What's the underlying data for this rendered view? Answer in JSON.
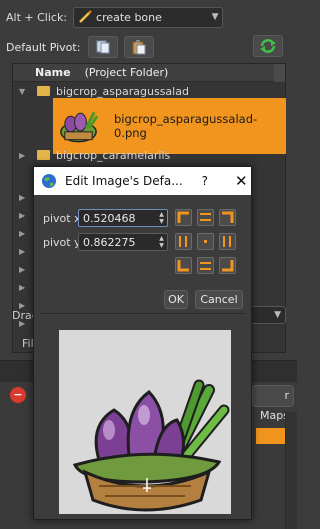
{
  "toolbar": {
    "alt_click_label": "Alt + Click:",
    "alt_click_value": "create bone",
    "default_pivot_label": "Default Pivot:"
  },
  "tree": {
    "col_name": "Name",
    "col_folder": "(Project Folder)",
    "folders": [
      "bigcrop_asparagussalad",
      "bigcrop_caramelarils"
    ],
    "selected_file": "bigcrop_asparagussalad-0.png"
  },
  "background": {
    "drag_label": "Drag",
    "file_label": "Fil",
    "maps_button": "r Maps"
  },
  "dialog": {
    "title": "Edit Image's Defa...",
    "help": "?",
    "close": "✕",
    "pivot_x_label": "pivot x",
    "pivot_x_value": "0.520468",
    "pivot_y_label": "pivot y",
    "pivot_y_value": "0.862275",
    "ok_label": "OK",
    "cancel_label": "Cancel"
  },
  "colors": {
    "selection": "#f2951f",
    "panel": "#3c3c3c",
    "folder": "#e2b44a"
  }
}
